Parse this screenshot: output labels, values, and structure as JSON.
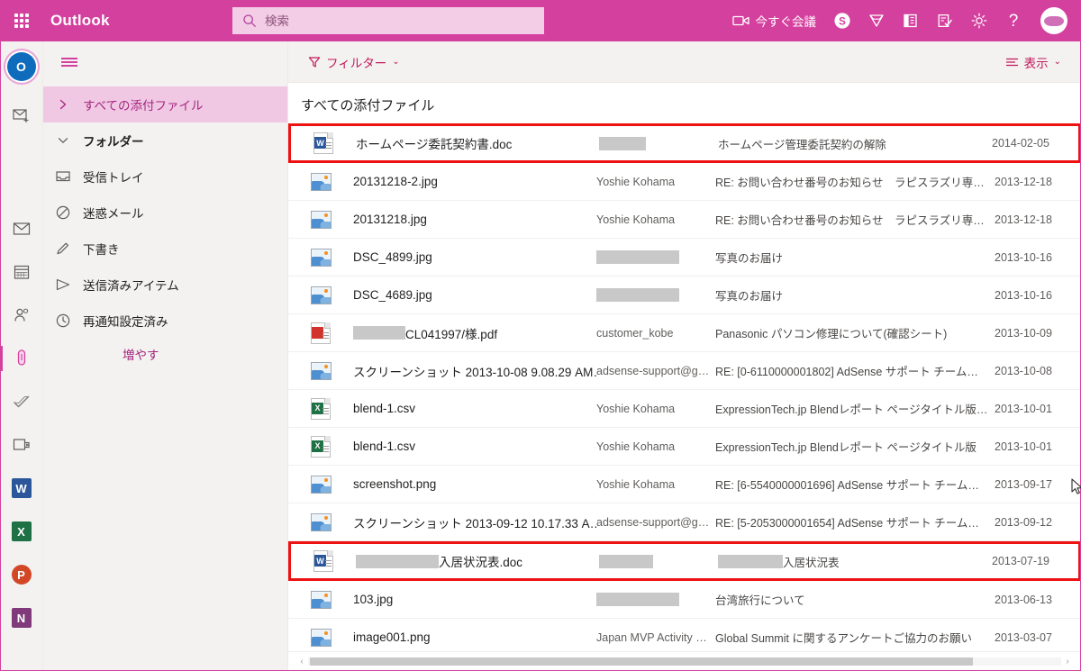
{
  "suite": {
    "waffle_label": "app-launcher",
    "brand": "Outlook",
    "search": {
      "placeholder": "検索",
      "value": ""
    },
    "meet_now": "今すぐ会議",
    "icons": {
      "camera": "camera-icon",
      "skype": "skype-icon",
      "diamond": "diamond-icon",
      "office": "office-icon",
      "tasks": "tasks-icon",
      "settings": "gear-icon",
      "help": "?",
      "avatar": "user-avatar"
    }
  },
  "rail": {
    "items": [
      {
        "name": "outlook-logo",
        "label": "Outlook"
      },
      {
        "name": "new-mail-icon",
        "label": "新規メール"
      },
      {
        "name": "mail-icon",
        "label": "メール"
      },
      {
        "name": "calendar-icon",
        "label": "予定表"
      },
      {
        "name": "people-icon",
        "label": "連絡先"
      },
      {
        "name": "attachments-icon",
        "label": "添付ファイル"
      },
      {
        "name": "todo-icon",
        "label": "To Do"
      },
      {
        "name": "bookings-icon",
        "label": "Bookings"
      },
      {
        "name": "word-icon",
        "label": "W"
      },
      {
        "name": "excel-icon",
        "label": "X"
      },
      {
        "name": "powerpoint-icon",
        "label": "P"
      },
      {
        "name": "onenote-icon",
        "label": "N"
      }
    ]
  },
  "folderpane": {
    "hamburger": "menu-icon",
    "items": [
      {
        "label": "すべての添付ファイル",
        "type": "chevron-right",
        "selected": true,
        "bold": false
      },
      {
        "label": "フォルダー",
        "type": "chevron-down",
        "selected": false,
        "bold": true
      },
      {
        "label": "受信トレイ",
        "type": "inbox",
        "selected": false,
        "bold": false
      },
      {
        "label": "迷惑メール",
        "type": "block",
        "selected": false,
        "bold": false
      },
      {
        "label": "下書き",
        "type": "pencil",
        "selected": false,
        "bold": false
      },
      {
        "label": "送信済みアイテム",
        "type": "send",
        "selected": false,
        "bold": false
      },
      {
        "label": "再通知設定済み",
        "type": "clock",
        "selected": false,
        "bold": false
      },
      {
        "label": "増やす",
        "type": "more",
        "selected": false,
        "bold": false
      }
    ]
  },
  "commandbar": {
    "filter_label": "フィルター",
    "filter_icon": "filter-icon",
    "view_label": "表示",
    "view_icon": "list-icon",
    "caret": "⌄"
  },
  "list": {
    "title": "すべての添付ファイル",
    "rows": [
      {
        "icon": "doc",
        "name": "ホームページ委託契約書.doc",
        "name_redact_w": 0,
        "from": "",
        "from_redact_w": 52,
        "subject": "ホームページ管理委託契約の解除",
        "subject_redact_w": 0,
        "date": "2014-02-05",
        "highlighted": true
      },
      {
        "icon": "image",
        "name": "20131218-2.jpg",
        "name_redact_w": 0,
        "from": "Yoshie Kohama",
        "from_redact_w": 0,
        "subject": "RE: お問い合わせ番号のお知らせ　ラピスラズリ専…",
        "subject_redact_w": 0,
        "date": "2013-12-18",
        "highlighted": false
      },
      {
        "icon": "image",
        "name": "20131218.jpg",
        "name_redact_w": 0,
        "from": "Yoshie Kohama",
        "from_redact_w": 0,
        "subject": "RE: お問い合わせ番号のお知らせ　ラピスラズリ専…",
        "subject_redact_w": 0,
        "date": "2013-12-18",
        "highlighted": false
      },
      {
        "icon": "image",
        "name": "DSC_4899.jpg",
        "name_redact_w": 0,
        "from": "",
        "from_redact_w": 92,
        "subject": "写真のお届け",
        "subject_redact_w": 0,
        "date": "2013-10-16",
        "highlighted": false
      },
      {
        "icon": "image",
        "name": "DSC_4689.jpg",
        "name_redact_w": 0,
        "from": "",
        "from_redact_w": 92,
        "subject": "写真のお届け",
        "subject_redact_w": 0,
        "date": "2013-10-16",
        "highlighted": false
      },
      {
        "icon": "pdf",
        "name": "CL041997/",
        "name_suffix": "様.pdf",
        "name_redact_w": 58,
        "from": "customer_kobe",
        "from_redact_w": 0,
        "subject": "Panasonic パソコン修理について(確認シート)",
        "subject_redact_w": 0,
        "date": "2013-10-09",
        "highlighted": false
      },
      {
        "icon": "image",
        "name": "スクリーンショット 2013-10-08 9.08.29 AM…",
        "name_redact_w": 0,
        "from": "adsense-support@g…",
        "from_redact_w": 0,
        "subject": "RE: [0-6110000001802] AdSense サポート チーム…",
        "subject_redact_w": 0,
        "date": "2013-10-08",
        "highlighted": false
      },
      {
        "icon": "xls",
        "name": "blend-1.csv",
        "name_redact_w": 0,
        "from": "Yoshie Kohama",
        "from_redact_w": 0,
        "subject": "ExpressionTech.jp Blendレポート ページタイトル版…",
        "subject_redact_w": 0,
        "date": "2013-10-01",
        "highlighted": false
      },
      {
        "icon": "xls",
        "name": "blend-1.csv",
        "name_redact_w": 0,
        "from": "Yoshie Kohama",
        "from_redact_w": 0,
        "subject": "ExpressionTech.jp Blendレポート ページタイトル版",
        "subject_redact_w": 0,
        "date": "2013-10-01",
        "highlighted": false
      },
      {
        "icon": "image",
        "name": "screenshot.png",
        "name_redact_w": 0,
        "from": "Yoshie Kohama",
        "from_redact_w": 0,
        "subject": "RE: [6-5540000001696] AdSense サポート チーム…",
        "subject_redact_w": 0,
        "date": "2013-09-17",
        "highlighted": false
      },
      {
        "icon": "image",
        "name": "スクリーンショット 2013-09-12 10.17.33 A…",
        "name_redact_w": 0,
        "from": "adsense-support@g…",
        "from_redact_w": 0,
        "subject": "RE: [5-2053000001654] AdSense サポート チーム…",
        "subject_redact_w": 0,
        "date": "2013-09-12",
        "highlighted": false
      },
      {
        "icon": "doc",
        "name": "",
        "name_suffix": "入居状況表.doc",
        "name_redact_w": 92,
        "from": "",
        "from_redact_w": 60,
        "subject": "",
        "subject_suffix": "入居状況表",
        "subject_redact_w": 72,
        "date": "2013-07-19",
        "highlighted": true
      },
      {
        "icon": "image",
        "name": "103.jpg",
        "name_redact_w": 0,
        "from": "",
        "from_redact_w": 92,
        "subject": "台湾旅行について",
        "subject_redact_w": 0,
        "date": "2013-06-13",
        "highlighted": false
      },
      {
        "icon": "image",
        "name": "image001.png",
        "name_redact_w": 0,
        "from": "Japan MVP Activity …",
        "from_redact_w": 0,
        "subject": "Global Summit に関するアンケートご協力のお願い",
        "subject_redact_w": 0,
        "date": "2013-03-07",
        "highlighted": false
      }
    ]
  },
  "scrollbars": {
    "left_arrow": "‹",
    "right_arrow": "›"
  },
  "colors": {
    "brand_pink": "#D4409E",
    "search_bg": "#F3CCE6",
    "selected_bg": "#F0C8E4",
    "accent_text": "#A4267E",
    "command_pink": "#C2185B",
    "highlight_box": "#EE1111",
    "pane_bg": "#F3F2F1",
    "redact_gray": "#C8C8C8"
  }
}
